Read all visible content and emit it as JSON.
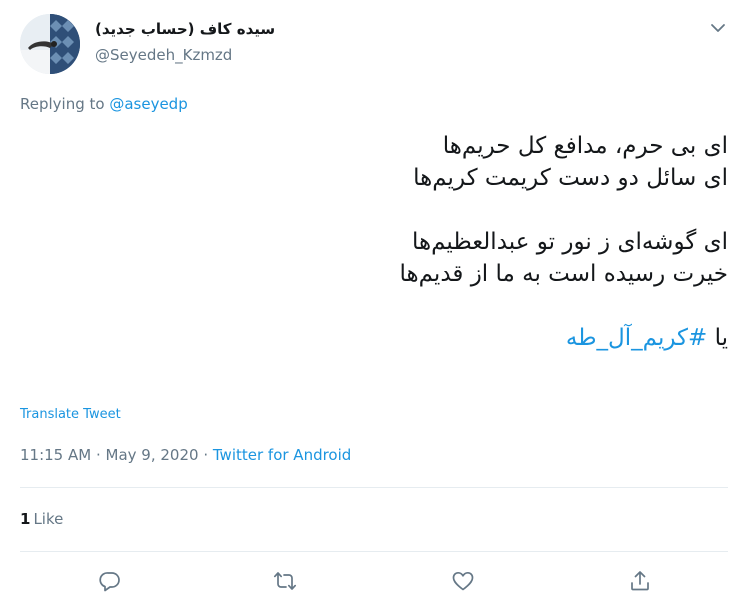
{
  "author": {
    "display_name": "سیده کاف (حساب جدید)",
    "handle": "@Seyedeh_Kzmzd"
  },
  "reply": {
    "prefix": "Replying to ",
    "to": "@aseyedp"
  },
  "tweet": {
    "lines": [
      "ای بی حرم، مدافع کل حریم‌ها",
      "ای سائل دو دست کریمت کریم‌ها",
      "",
      "ای گوشه‌ای ز نور تو عبدالعظیم‌ها",
      "خیرت رسیده است به ما از قدیم‌ها",
      ""
    ],
    "last_prefix": "یا ",
    "hashtag": "#کریم_آل_طه"
  },
  "translate_label": "Translate Tweet",
  "meta": {
    "time": "11:15 AM",
    "sep1": " · ",
    "date": "May 9, 2020",
    "sep2": " · ",
    "source": "Twitter for Android"
  },
  "stats": {
    "like_count": "1",
    "like_label": "Like"
  },
  "icons": {
    "caret": "chevron-down-icon",
    "reply": "reply-icon",
    "retweet": "retweet-icon",
    "like": "heart-icon",
    "share": "share-icon"
  },
  "colors": {
    "link": "#1b95e0",
    "secondary_text": "#657786",
    "primary_text": "#14171a",
    "divider": "#e6ecf0"
  }
}
